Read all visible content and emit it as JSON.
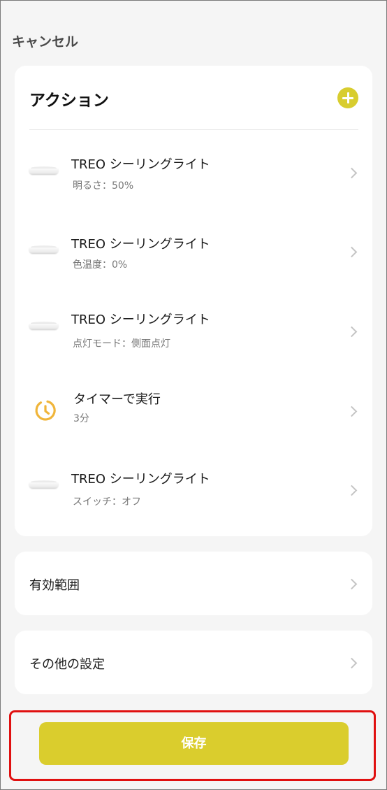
{
  "header": {
    "cancel_label": "キャンセル"
  },
  "actions": {
    "title": "アクション",
    "add_icon": "plus-circle-icon",
    "accent_color": "#dacd2d",
    "items": [
      {
        "type": "device",
        "icon": "ceiling-light-icon",
        "title": "TREO シーリングライト",
        "subtitle": "明るさ：50%"
      },
      {
        "type": "device",
        "icon": "ceiling-light-icon",
        "title": "TREO シーリングライト",
        "subtitle": "色温度：0%"
      },
      {
        "type": "device",
        "icon": "ceiling-light-icon",
        "title": "TREO シーリングライト",
        "subtitle": "点灯モード：側面点灯"
      },
      {
        "type": "timer",
        "icon": "timer-icon",
        "title": "タイマーで実行",
        "subtitle": "3分"
      },
      {
        "type": "device",
        "icon": "ceiling-light-icon",
        "title": "TREO シーリングライト",
        "subtitle": "スイッチ：オフ"
      }
    ]
  },
  "settings": {
    "scope_label": "有効範囲",
    "other_label": "その他の設定"
  },
  "footer": {
    "save_label": "保存",
    "highlight_color": "#e01010"
  }
}
